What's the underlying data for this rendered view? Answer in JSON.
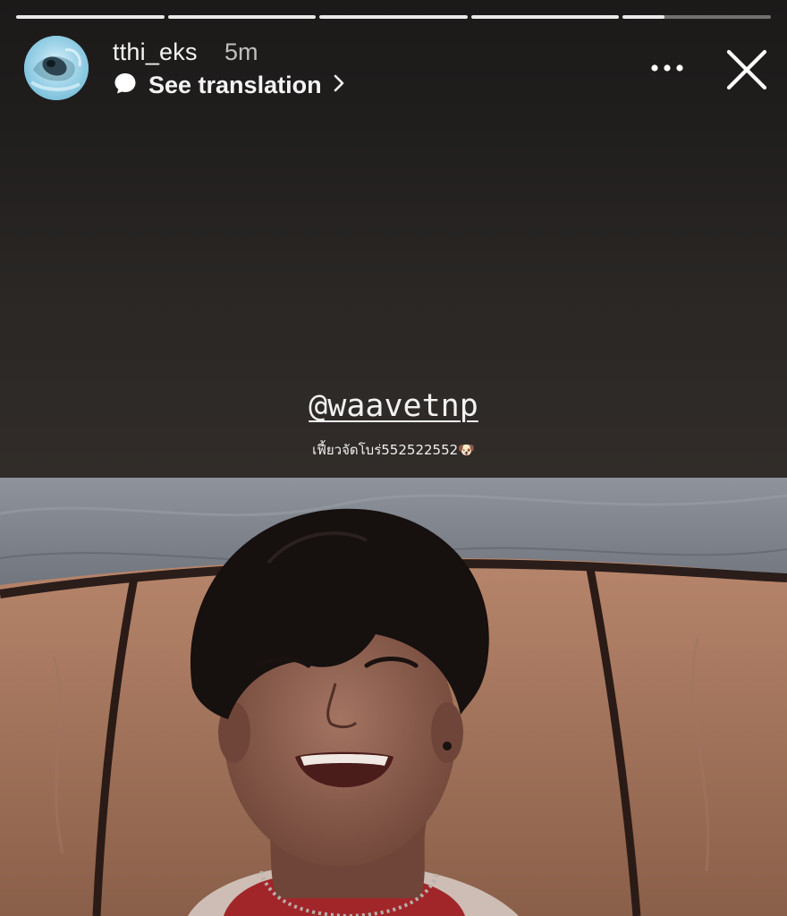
{
  "progress": {
    "segments": [
      1,
      1,
      1,
      1,
      0.28
    ]
  },
  "header": {
    "username": "tthi_eks",
    "time_ago": "5m",
    "translation_label": "See translation"
  },
  "sticker": {
    "mention": "@waavetnp",
    "caption": "เฟี้ยวจัดโบร่552522552🐶"
  },
  "colors": {
    "accent_text": "#ffffff",
    "progress_fill": "#e9e9e9",
    "progress_track": "rgba(255,255,255,0.38)"
  },
  "icons": {
    "translate": "speech-bubble-icon",
    "chevron": "chevron-right-icon",
    "more": "ellipsis-icon",
    "close": "close-icon"
  }
}
